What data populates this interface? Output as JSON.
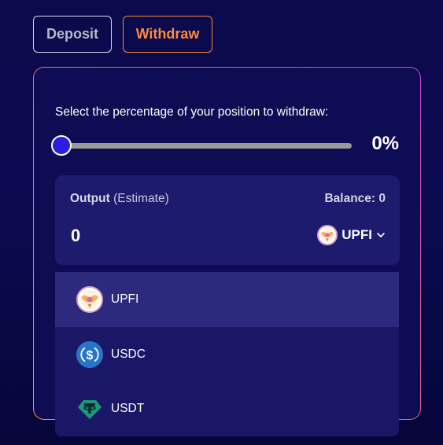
{
  "tabs": {
    "deposit_label": "Deposit",
    "withdraw_label": "Withdraw",
    "active": "Withdraw"
  },
  "withdraw": {
    "prompt": "Select the percentage of your position to withdraw:",
    "slider_value_percent": 0,
    "percent_display": "0%"
  },
  "output": {
    "label": "Output",
    "label_suffix": "(Estimate)",
    "balance_text": "Balance: 0",
    "value": "0",
    "selected_token": "UPFI",
    "selected_token_icon": "upfi-icon",
    "chevron_icon": "chevron-down-icon"
  },
  "token_dropdown": {
    "items": [
      {
        "symbol": "UPFI",
        "icon": "upfi-icon",
        "highlighted": true
      },
      {
        "symbol": "USDC",
        "icon": "usdc-icon",
        "highlighted": false
      },
      {
        "symbol": "USDT",
        "icon": "usdt-icon",
        "highlighted": false
      }
    ]
  },
  "colors": {
    "background": "#0b0a4a",
    "card": "#0e0c52",
    "accent_orange": "#ff8a3d",
    "slider_thumb": "#2a1ee0",
    "output_box": "#1d1b6e",
    "dropdown": "#1b1767",
    "dropdown_highlight": "#2c2a7c",
    "usdc_blue": "#2775ca",
    "usdt_green": "#1f8a74"
  }
}
